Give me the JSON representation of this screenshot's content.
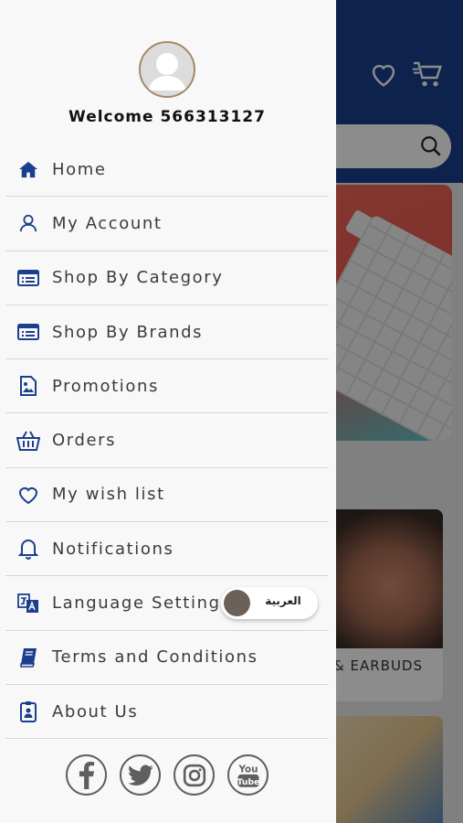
{
  "colors": {
    "accent": "#1b3f8e",
    "drawer_bg": "#f8f8f8",
    "menu_text": "#3b3b3b"
  },
  "drawer": {
    "welcome": "Welcome 566313127",
    "menu": [
      {
        "label": "Home",
        "icon": "home-icon"
      },
      {
        "label": "My Account",
        "icon": "user-icon"
      },
      {
        "label": "Shop By Category",
        "icon": "list-icon"
      },
      {
        "label": "Shop By Brands",
        "icon": "list-icon"
      },
      {
        "label": "Promotions",
        "icon": "image-icon"
      },
      {
        "label": "Orders",
        "icon": "basket-icon"
      },
      {
        "label": "My wish list",
        "icon": "heart-icon"
      },
      {
        "label": "Notifications",
        "icon": "bell-icon"
      },
      {
        "label": "Language Setting",
        "icon": "translate-icon"
      },
      {
        "label": "Terms and Conditions",
        "icon": "book-icon"
      },
      {
        "label": "About Us",
        "icon": "id-badge-icon"
      }
    ],
    "language_toggle_label": "العربية",
    "social": [
      "facebook-icon",
      "twitter-icon",
      "instagram-icon",
      "youtube-icon"
    ]
  },
  "background": {
    "product_label": "& EARBUDS"
  }
}
